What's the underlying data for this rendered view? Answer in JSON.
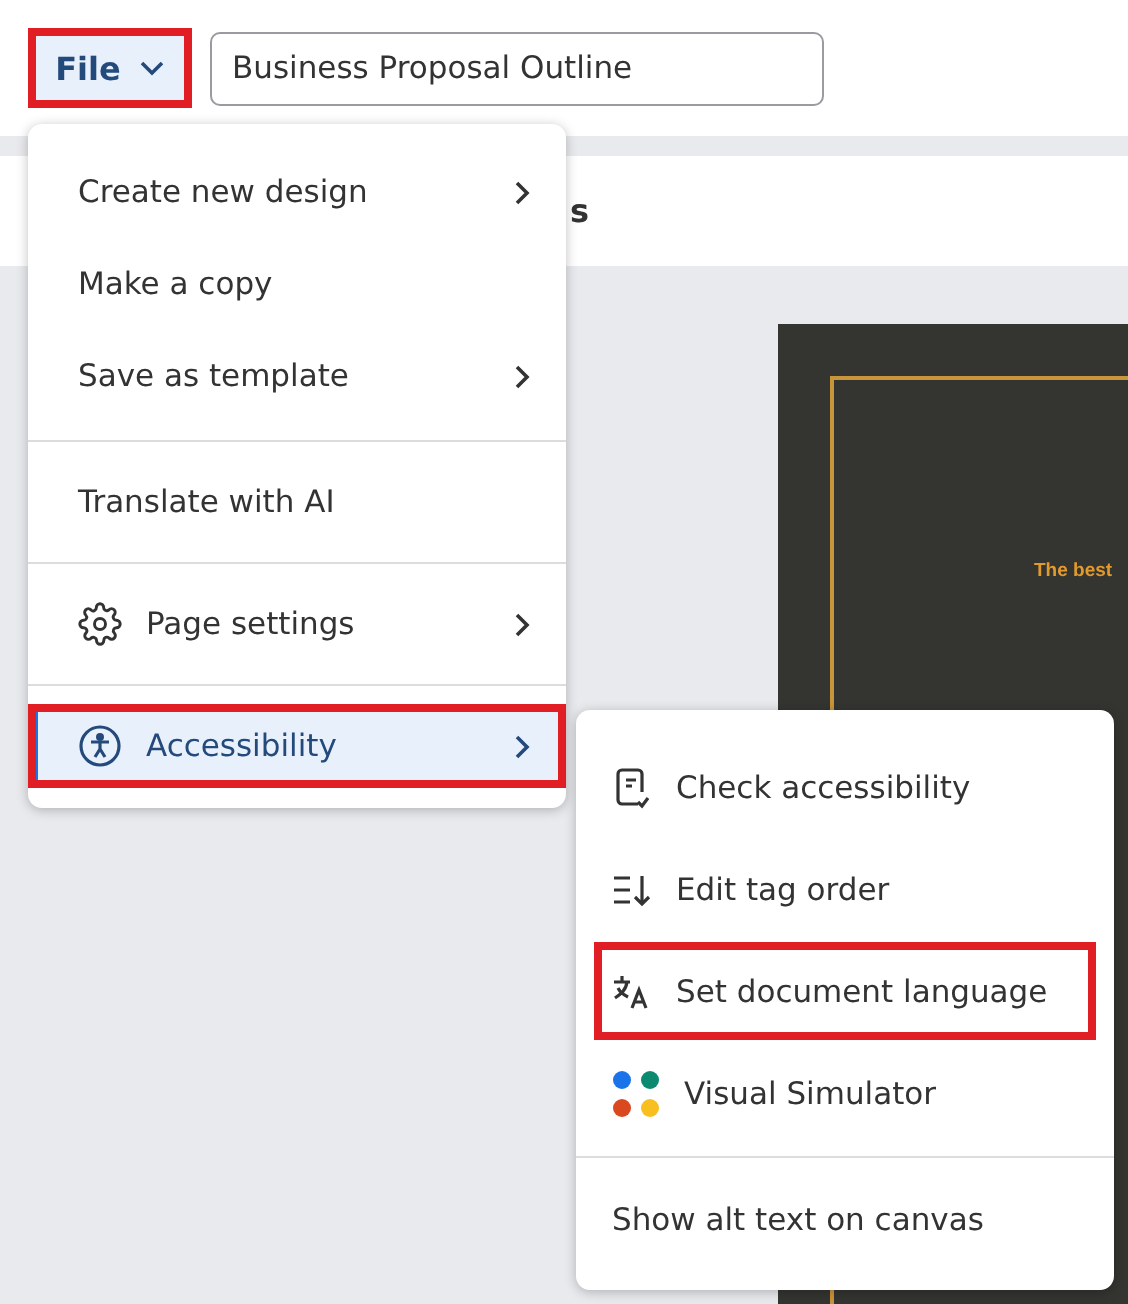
{
  "file_button": {
    "label": "File",
    "highlighted": true
  },
  "title_field": {
    "value": "Business Proposal Outline"
  },
  "toolbar": {
    "text": "s"
  },
  "design": {
    "tagline": "The best"
  },
  "file_menu": {
    "items": [
      {
        "kind": "item",
        "label": "Create new design",
        "submenu": true,
        "selected": false,
        "highlighted": false
      },
      {
        "kind": "item",
        "label": "Make a copy",
        "submenu": false,
        "selected": false,
        "highlighted": false
      },
      {
        "kind": "item",
        "label": "Save as template",
        "submenu": true,
        "selected": false,
        "highlighted": false
      },
      {
        "kind": "divider"
      },
      {
        "kind": "item",
        "label": "Translate with AI",
        "submenu": false,
        "selected": false,
        "highlighted": false
      },
      {
        "kind": "divider"
      },
      {
        "kind": "item",
        "label": "Page settings",
        "submenu": true,
        "selected": false,
        "highlighted": false
      },
      {
        "kind": "divider"
      },
      {
        "kind": "item",
        "label": "Accessibility",
        "submenu": true,
        "selected": true,
        "highlighted": true
      }
    ]
  },
  "accessibility_menu": {
    "items": [
      {
        "kind": "item",
        "label": "Check accessibility",
        "highlighted": false
      },
      {
        "kind": "item",
        "label": "Edit tag order",
        "highlighted": false
      },
      {
        "kind": "item",
        "label": "Set document language",
        "highlighted": true
      },
      {
        "kind": "item",
        "label": "Visual Simulator",
        "highlighted": false
      },
      {
        "kind": "divider"
      },
      {
        "kind": "item",
        "label": "Show alt text on canvas",
        "highlighted": false
      }
    ]
  }
}
